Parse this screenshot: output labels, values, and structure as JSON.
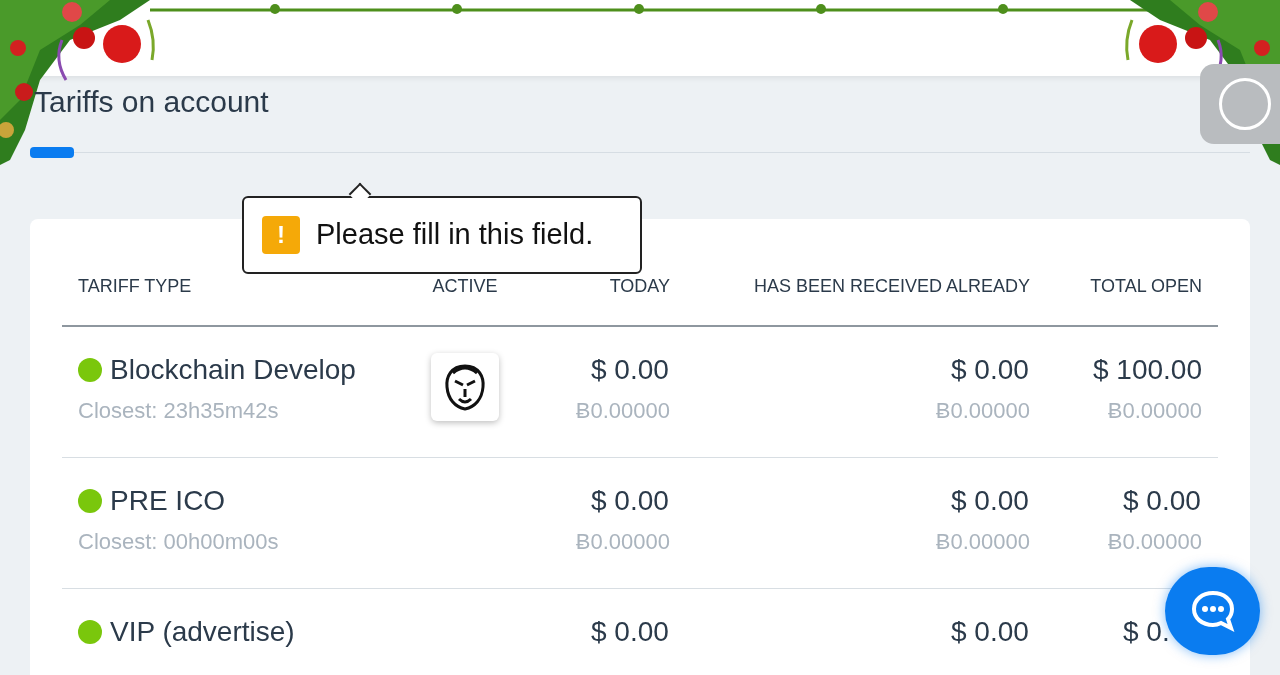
{
  "page": {
    "title": "Tariffs on account"
  },
  "tooltip": {
    "icon": "!",
    "message": "Please fill in this field."
  },
  "table": {
    "columns": [
      "TARIFF TYPE",
      "ACTIVE",
      "TODAY",
      "HAS BEEN RECEIVED ALREADY",
      "TOTAL OPEN"
    ],
    "rows": [
      {
        "name": "Blockchain Develop",
        "color": "#7ac70c",
        "closest": "Closest: 23h35m42s",
        "has_logo": true,
        "today": "$ 0.00",
        "today_btc": "Ƀ0.00000",
        "received": "$ 0.00",
        "received_btc": "Ƀ0.00000",
        "total": "$ 100.00",
        "total_btc": "Ƀ0.00000"
      },
      {
        "name": "PRE ICO",
        "color": "#7ac70c",
        "closest": "Closest: 00h00m00s",
        "has_logo": false,
        "today": "$ 0.00",
        "today_btc": "Ƀ0.00000",
        "received": "$ 0.00",
        "received_btc": "Ƀ0.00000",
        "total": "$ 0.00",
        "total_btc": "Ƀ0.00000"
      },
      {
        "name": "VIP (advertise)",
        "color": "#7ac70c",
        "has_logo": false,
        "today": "$ 0.00",
        "received": "$ 0.00",
        "total": "$ 0."
      }
    ]
  }
}
